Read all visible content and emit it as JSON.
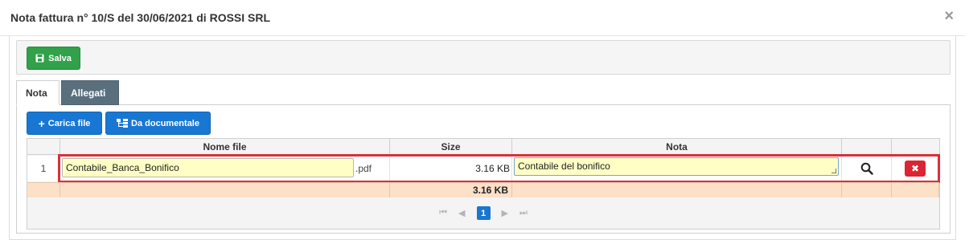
{
  "dialog": {
    "title": "Nota fattura n° 10/S del 30/06/2021 di ROSSI SRL",
    "close_glyph": "×"
  },
  "toolbar": {
    "save_label": "Salva"
  },
  "tabs": [
    {
      "label": "Nota",
      "active": false
    },
    {
      "label": "Allegati",
      "active": true
    }
  ],
  "attachments": {
    "upload_label": "Carica file",
    "from_docs_label": "Da documentale",
    "columns": [
      "Nome file",
      "Size",
      "Nota"
    ],
    "rows": [
      {
        "num": "1",
        "file_name": "Contabile_Banca_Bonifico",
        "extension": ".pdf",
        "size": "3.16 KB",
        "note": "Contabile del bonifico"
      }
    ],
    "total_size": "3.16 KB",
    "pager": {
      "first": "⏮",
      "prev": "◀",
      "current": "1",
      "next": "▶",
      "last": "⏭"
    }
  },
  "colors": {
    "save": "#31a14a",
    "primary": "#1877d2",
    "delete": "#dc2433",
    "input_bg": "#ffffc5",
    "totals_bg": "#fde0c8",
    "highlight": "#d9303c"
  }
}
